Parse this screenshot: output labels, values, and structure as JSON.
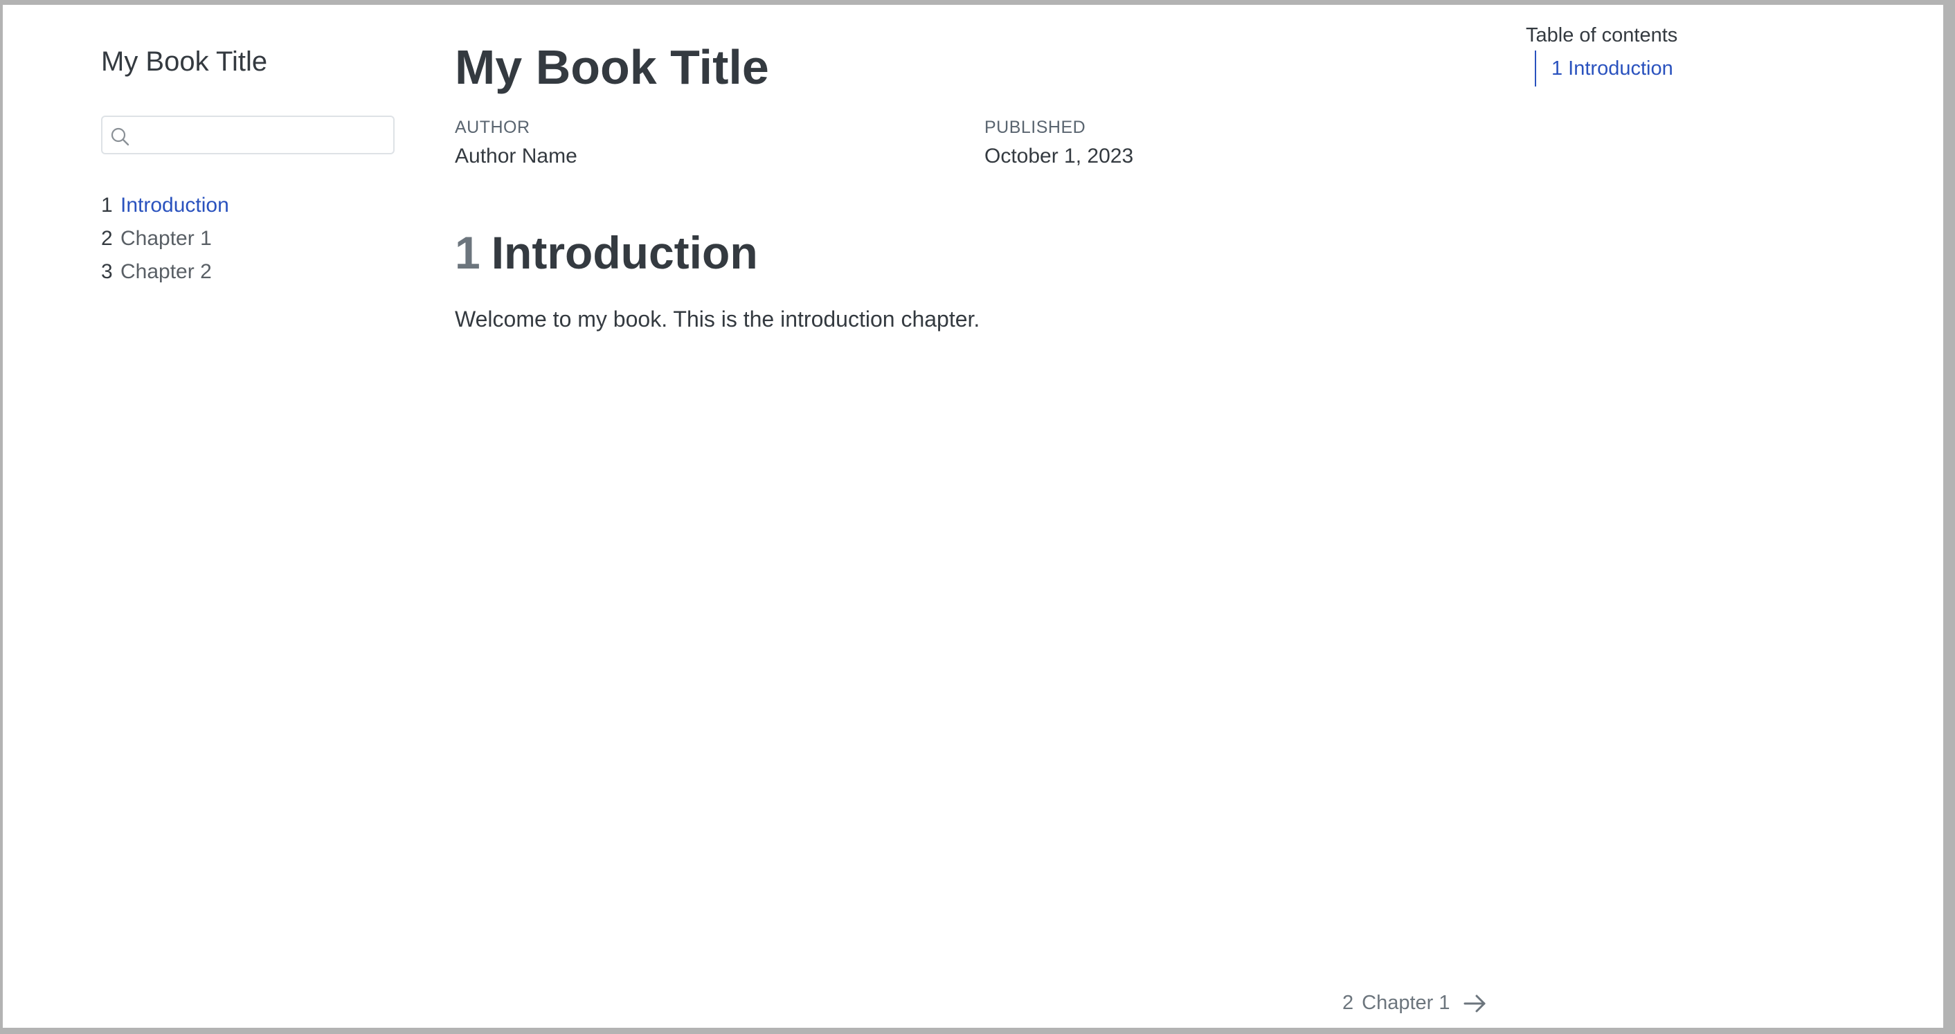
{
  "sidebar": {
    "title": "My Book Title",
    "search": {
      "value": "",
      "placeholder": ""
    },
    "items": [
      {
        "number": "1",
        "label": "Introduction",
        "active": true
      },
      {
        "number": "2",
        "label": "Chapter 1",
        "active": false
      },
      {
        "number": "3",
        "label": "Chapter 2",
        "active": false
      }
    ]
  },
  "main": {
    "title": "My Book Title",
    "meta": {
      "author_label": "AUTHOR",
      "author_value": "Author Name",
      "published_label": "PUBLISHED",
      "published_value": "October 1, 2023"
    },
    "section": {
      "number": "1",
      "heading": "Introduction",
      "body": "Welcome to my book. This is the introduction chapter."
    }
  },
  "toc": {
    "title": "Table of contents",
    "items": [
      {
        "label": "1 Introduction"
      }
    ]
  },
  "page_nav": {
    "next_number": "2",
    "next_label": "Chapter 1",
    "next_icon": "arrow-right-icon"
  },
  "colors": {
    "link": "#2a52be",
    "text": "#343a40",
    "muted": "#6c757d"
  }
}
